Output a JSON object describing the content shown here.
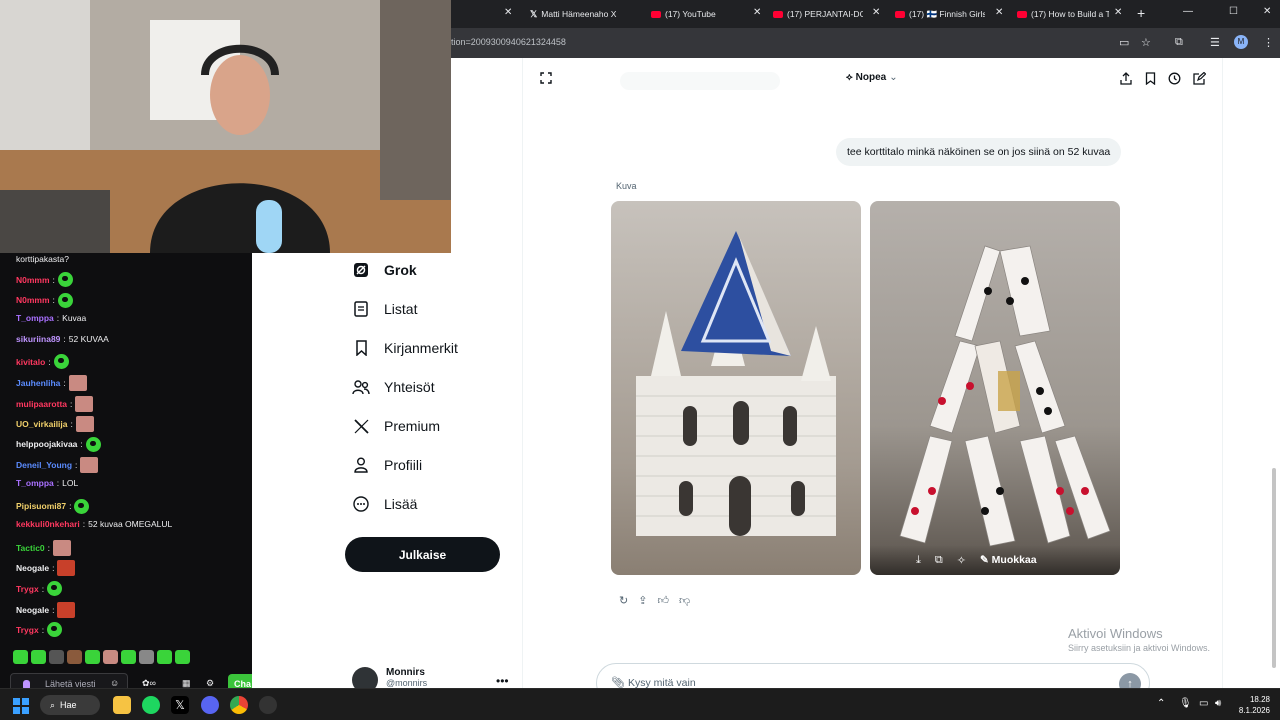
{
  "browser": {
    "tabs": [
      {
        "label": "Matti Hämeenaho X",
        "icon": "x-logo-icon"
      },
      {
        "label": "(17) YouTube",
        "icon": "youtube-icon"
      },
      {
        "label": "(17) PERJANTAI-DOK",
        "icon": "youtube-icon"
      },
      {
        "label": "(17) 🇫🇮 Finnish Girls A",
        "icon": "youtube-icon"
      },
      {
        "label": "(17) How to Build a T",
        "icon": "youtube-icon"
      }
    ],
    "url_fragment": "tion=2009300940621324458",
    "profile_initial": "M"
  },
  "sidebar": {
    "items": [
      {
        "label": "Grok",
        "icon": "grok-icon"
      },
      {
        "label": "Listat",
        "icon": "list-icon"
      },
      {
        "label": "Kirjanmerkit",
        "icon": "bookmark-icon"
      },
      {
        "label": "Yhteisöt",
        "icon": "communities-icon"
      },
      {
        "label": "Premium",
        "icon": "x-logo-icon"
      },
      {
        "label": "Profiili",
        "icon": "profile-icon"
      },
      {
        "label": "Lisää",
        "icon": "more-circle-icon"
      }
    ],
    "post_button": "Julkaise",
    "user": {
      "name": "Monnirs",
      "handle": "@monnirs"
    }
  },
  "grok": {
    "mode_label": "Nopea",
    "user_message": "tee korttitalo minkä näköinen se on jos siinä on 52 kuvaa",
    "response_label": "Kuva",
    "edit_label": "Muokkaa",
    "input_placeholder": "Kysy mitä vain",
    "watermark_title": "Aktivoi Windows",
    "watermark_sub": "Siirry asetuksiin ja aktivoi Windows."
  },
  "chat": {
    "first_line": "korttipakasta?",
    "messages": [
      {
        "user": "N0mmm",
        "color": "#ff3860",
        "text": "",
        "emote": "green"
      },
      {
        "user": "N0mmm",
        "color": "#ff3860",
        "text": "",
        "emote": "green"
      },
      {
        "user": "T_omppa",
        "color": "#a970ff",
        "text": "Kuvaa",
        "emote": ""
      },
      {
        "user": "sikuriina89",
        "color": "#bf94ff",
        "text": "52 KUVAA",
        "emote": ""
      },
      {
        "user": "kivitalo",
        "color": "#ff3860",
        "text": "",
        "emote": "green"
      },
      {
        "user": "Jauhenliha",
        "color": "#5b8cff",
        "text": "",
        "emote": "pink"
      },
      {
        "user": "mulipaarotta",
        "color": "#ff3860",
        "text": "",
        "emote": "pink"
      },
      {
        "user": "UO_virkailija",
        "color": "#f2d16b",
        "text": "",
        "emote": "pink"
      },
      {
        "user": "helppoojakivaa",
        "color": "#efeff1",
        "text": "",
        "emote": "green"
      },
      {
        "user": "Deneil_Young",
        "color": "#5b8cff",
        "text": "",
        "emote": "pink"
      },
      {
        "user": "T_omppa",
        "color": "#a970ff",
        "text": "LOL",
        "emote": ""
      },
      {
        "user": "Pipisuomi87",
        "color": "#f2d16b",
        "text": "",
        "emote": "green"
      },
      {
        "user": "kekkuli0nkehari",
        "color": "#ff3860",
        "text": "52 kuvaa OMEGALUL",
        "emote": ""
      },
      {
        "user": "Tactic0",
        "color": "#3ad43a",
        "text": "",
        "emote": "pink"
      },
      {
        "user": "Neogale",
        "color": "#efeff1",
        "text": "",
        "emote": "red"
      },
      {
        "user": "Trygx",
        "color": "#ff3860",
        "text": "",
        "emote": "green"
      },
      {
        "user": "Neogale",
        "color": "#efeff1",
        "text": "",
        "emote": "red"
      },
      {
        "user": "Trygx",
        "color": "#ff3860",
        "text": "",
        "emote": "green"
      }
    ],
    "input_placeholder": "Lähetä viesti",
    "send_label": "Cha"
  },
  "taskbar": {
    "search_label": "Hae",
    "time": "18.28",
    "date": "8.1.2026"
  },
  "colors": {
    "x_black": "#0f1419",
    "chrome_dark": "#202124",
    "twitch_bg": "#0e0e10",
    "twitch_green": "#3ad43a"
  }
}
